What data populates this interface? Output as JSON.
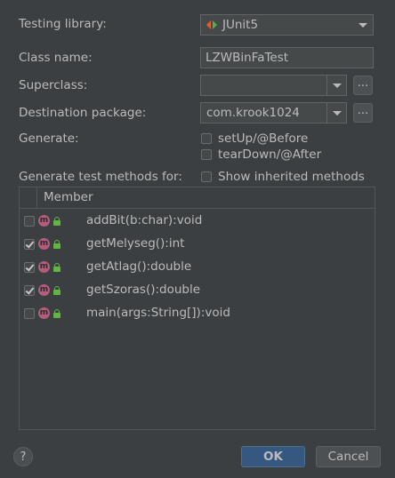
{
  "form": {
    "testing_library_label": "Testing library:",
    "testing_library_value": "JUnit5",
    "class_name_label": "Class name:",
    "class_name_value": "LZWBinFaTest",
    "superclass_label": "Superclass:",
    "superclass_value": "",
    "superclass_browse": "...",
    "destination_package_label": "Destination package:",
    "destination_package_value": "com.krook1024",
    "destination_package_browse": "...",
    "generate_label": "Generate:",
    "setup_label": "setUp/@Before",
    "setup_checked": false,
    "teardown_label": "tearDown/@After",
    "teardown_checked": false,
    "generate_methods_label": "Generate test methods for:",
    "show_inherited_label": "Show inherited methods",
    "show_inherited_checked": false
  },
  "members": {
    "header": "Member",
    "items": [
      {
        "name": "addBit(b:char):void",
        "checked": false,
        "badge": "m"
      },
      {
        "name": "getMelyseg():int",
        "checked": true,
        "badge": "m"
      },
      {
        "name": "getAtlag():double",
        "checked": true,
        "badge": "m"
      },
      {
        "name": "getSzoras():double",
        "checked": true,
        "badge": "m"
      },
      {
        "name": "main(args:String[]):void",
        "checked": false,
        "badge": "m"
      }
    ]
  },
  "footer": {
    "help": "?",
    "ok": "OK",
    "cancel": "Cancel"
  },
  "colors": {
    "background": "#3c3f41",
    "ok_button": "#365880",
    "method_badge": "#b65b7a",
    "lock": "#62b543"
  }
}
